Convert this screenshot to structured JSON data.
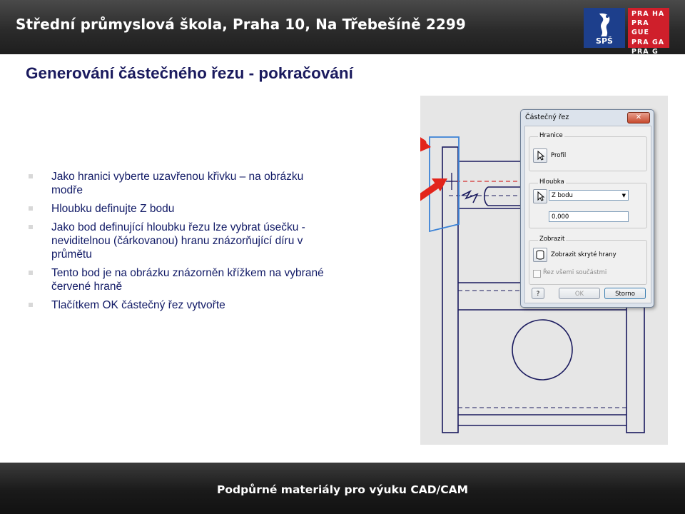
{
  "header": {
    "school_name": "Střední průmyslová škola, Praha 10, Na Třebešíně 2299",
    "logo_text": "SPŠ",
    "praha_logo_lines": [
      "PRA HA",
      "PRA GUE",
      "PRA GA",
      "PRA G"
    ]
  },
  "slide": {
    "title": "Generování částečného řezu - pokračování",
    "bullets": [
      "Jako hranici vyberte uzavřenou křivku – na obrázku modře",
      "Hloubku definujte Z bodu",
      "Jako bod definující hloubku řezu lze vybrat úsečku - neviditelnou (čárkovanou) hranu znázorňující díru v průmětu",
      "Tento bod je na obrázku znázorněn křížkem na vybrané červené hraně",
      "Tlačítkem OK částečný řez vytvořte"
    ]
  },
  "dialog": {
    "title": "Částečný řez",
    "close_label": "✕",
    "boundary_group": "Hranice",
    "profile_label": "Profil",
    "depth_group": "Hloubka",
    "depth_option": "Z bodu",
    "depth_value": "0,000",
    "display_group": "Zobrazit",
    "show_hidden_label": "Zobrazit skryté hrany",
    "section_all_label": "Řez všemi součástmi",
    "help_label": "?",
    "ok_label": "OK",
    "cancel_label": "Storno"
  },
  "footer": {
    "text": "Podpůrné materiály pro výuku CAD/CAM"
  },
  "colors": {
    "drawing_line": "#1a1a5e",
    "boundary": "#3b82d6",
    "arrow": "#e3241b",
    "dashed_edge": "#d43030"
  }
}
